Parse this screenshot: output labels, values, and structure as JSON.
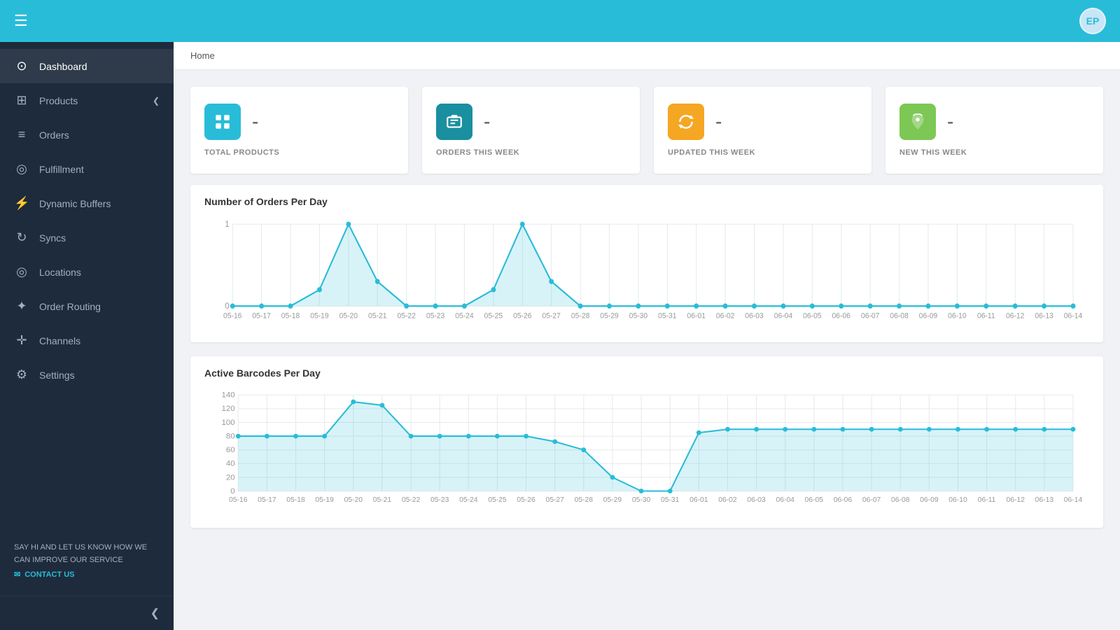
{
  "topbar": {
    "hamburger": "☰",
    "avatar_label": "EP"
  },
  "sidebar": {
    "items": [
      {
        "id": "dashboard",
        "label": "Dashboard",
        "icon": "⊙",
        "active": true
      },
      {
        "id": "products",
        "label": "Products",
        "icon": "⊞",
        "has_arrow": true
      },
      {
        "id": "orders",
        "label": "Orders",
        "icon": "≡"
      },
      {
        "id": "fulfillment",
        "label": "Fulfillment",
        "icon": "◎"
      },
      {
        "id": "dynamic-buffers",
        "label": "Dynamic Buffers",
        "icon": "⚡"
      },
      {
        "id": "syncs",
        "label": "Syncs",
        "icon": "↻"
      },
      {
        "id": "locations",
        "label": "Locations",
        "icon": "◎"
      },
      {
        "id": "order-routing",
        "label": "Order Routing",
        "icon": "✦"
      },
      {
        "id": "channels",
        "label": "Channels",
        "icon": "✛"
      },
      {
        "id": "settings",
        "label": "Settings",
        "icon": "⚙"
      }
    ],
    "footer_text": "SAY HI AND LET US KNOW HOW WE CAN IMPROVE OUR SERVICE",
    "contact_label": "CONTACT US"
  },
  "breadcrumb": "Home",
  "stats": [
    {
      "id": "total-products",
      "label": "TOTAL PRODUCTS",
      "value": "-",
      "icon": "⊞",
      "color": "blue"
    },
    {
      "id": "orders-this-week",
      "label": "ORDERS THIS WEEK",
      "value": "-",
      "icon": "$",
      "color": "teal"
    },
    {
      "id": "updated-this-week",
      "label": "UPDATED THIS WEEK",
      "value": "-",
      "icon": "↻",
      "color": "orange"
    },
    {
      "id": "new-this-week",
      "label": "NEW THIS WEEK",
      "value": "-",
      "icon": "☁",
      "color": "green"
    }
  ],
  "chart1": {
    "title": "Number of Orders Per Day",
    "x_labels": [
      "05-16",
      "05-17",
      "05-18",
      "05-19",
      "05-20",
      "05-21",
      "05-22",
      "05-23",
      "05-24",
      "05-25",
      "05-26",
      "05-27",
      "05-28",
      "05-29",
      "05-30",
      "05-31",
      "06-01",
      "06-02",
      "06-03",
      "06-04",
      "06-05",
      "06-06",
      "06-07",
      "06-08",
      "06-09",
      "06-10",
      "06-11",
      "06-12",
      "06-13",
      "06-14"
    ],
    "y_labels": [
      "0",
      "1"
    ],
    "values": [
      0,
      0,
      0,
      0.2,
      1,
      0.3,
      0,
      0,
      0,
      0.2,
      1,
      0.3,
      0,
      0,
      0,
      0,
      0,
      0,
      0,
      0,
      0,
      0,
      0,
      0,
      0,
      0,
      0,
      0,
      0,
      0
    ]
  },
  "chart2": {
    "title": "Active Barcodes Per Day",
    "x_labels": [
      "05-16",
      "05-17",
      "05-18",
      "05-19",
      "05-20",
      "05-21",
      "05-22",
      "05-23",
      "05-24",
      "05-25",
      "05-26",
      "05-27",
      "05-28",
      "05-29",
      "05-30",
      "05-31",
      "06-01",
      "06-02",
      "06-03",
      "06-04",
      "06-05",
      "06-06",
      "06-07",
      "06-08",
      "06-09",
      "06-10",
      "06-11",
      "06-12",
      "06-13",
      "06-14"
    ],
    "y_labels": [
      "0",
      "20",
      "40",
      "60",
      "80",
      "100",
      "120",
      "140"
    ],
    "values": [
      80,
      80,
      80,
      80,
      130,
      125,
      80,
      80,
      80,
      80,
      80,
      72,
      60,
      20,
      0,
      0,
      85,
      90,
      90,
      90,
      90,
      90,
      90,
      90,
      90,
      90,
      90,
      90,
      90,
      90
    ]
  }
}
